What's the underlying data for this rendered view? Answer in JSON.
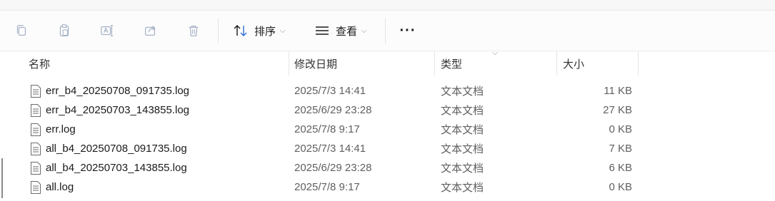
{
  "toolbar": {
    "copy_icon": "copy-icon",
    "paste_icon": "paste-icon",
    "rename_icon": "rename-icon",
    "share_icon": "share-icon",
    "delete_icon": "trash-icon",
    "sort_label": "排序",
    "view_label": "查看",
    "more_label": "···"
  },
  "columns": {
    "name": "名称",
    "date": "修改日期",
    "type": "类型",
    "size": "大小"
  },
  "files": [
    {
      "name": "err_b4_20250708_091735.log",
      "date": "2025/7/3 14:41",
      "type": "文本文档",
      "size": "11 KB"
    },
    {
      "name": "err_b4_20250703_143855.log",
      "date": "2025/6/29 23:28",
      "type": "文本文档",
      "size": "27 KB"
    },
    {
      "name": "err.log",
      "date": "2025/7/8 9:17",
      "type": "文本文档",
      "size": "0 KB"
    },
    {
      "name": "all_b4_20250708_091735.log",
      "date": "2025/7/3 14:41",
      "type": "文本文档",
      "size": "7 KB"
    },
    {
      "name": "all_b4_20250703_143855.log",
      "date": "2025/6/29 23:28",
      "type": "文本文档",
      "size": "6 KB"
    },
    {
      "name": "all.log",
      "date": "2025/7/8 9:17",
      "type": "文本文档",
      "size": "0 KB"
    }
  ]
}
